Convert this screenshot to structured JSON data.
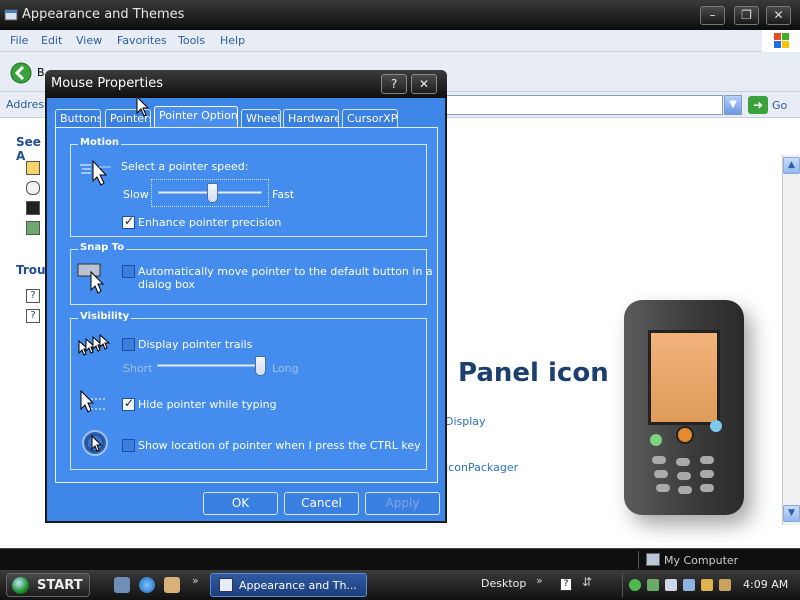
{
  "explorer": {
    "title": "Appearance and Themes",
    "menu": [
      "File",
      "Edit",
      "View",
      "Favorites",
      "Tools",
      "Help"
    ],
    "back_label": "B",
    "address_label": "Address",
    "go_label": "Go",
    "left_panel": {
      "see_also_heading": "See A",
      "troubleshooters_heading": "Troul"
    },
    "main": {
      "heading": "Panel icon",
      "link_display": "Display",
      "link_iconpackager": "IconPackager"
    },
    "status_bar": {
      "location": "My Computer"
    }
  },
  "dialog": {
    "title": "Mouse Properties",
    "help_button": "?",
    "close_button": "✕",
    "tabs": [
      {
        "label": "Buttons"
      },
      {
        "label": "Pointers"
      },
      {
        "label": "Pointer Options",
        "active": true
      },
      {
        "label": "Wheel"
      },
      {
        "label": "Hardware"
      },
      {
        "label": "CursorXP"
      }
    ],
    "motion": {
      "legend": "Motion",
      "speed_label": "Select a pointer speed:",
      "slow": "Slow",
      "fast": "Fast",
      "speed_level": 0.5,
      "enhance_label": "Enhance pointer precision",
      "enhance_checked": true
    },
    "snap_to": {
      "legend": "Snap To",
      "auto_move_label": "Automatically move pointer to the default button in a",
      "auto_move_label_line2": "dialog box",
      "auto_move_checked": false
    },
    "visibility": {
      "legend": "Visibility",
      "trails_label": "Display pointer trails",
      "trails_checked": false,
      "short": "Short",
      "long": "Long",
      "trail_level": 1.0,
      "hide_typing_label": "Hide pointer while typing",
      "hide_typing_checked": true,
      "ctrl_label": "Show location of pointer when I press the CTRL key",
      "ctrl_checked": false
    },
    "buttons": {
      "ok": "OK",
      "cancel": "Cancel",
      "apply": "Apply"
    }
  },
  "taskbar": {
    "start": "START",
    "task_window": "Appearance and Th...",
    "desktop": "Desktop",
    "clock": "4:09 AM"
  }
}
